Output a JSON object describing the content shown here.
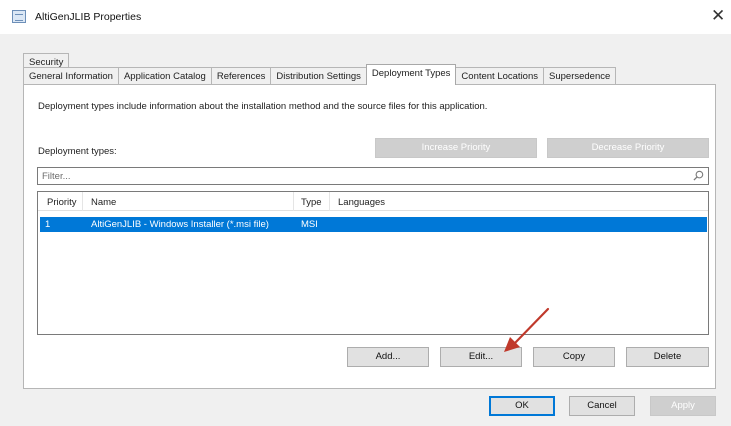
{
  "window": {
    "title": "AltiGenJLIB Properties",
    "close_symbol": "✕"
  },
  "tabs": {
    "row1": [
      {
        "label": "Security"
      }
    ],
    "row2": [
      {
        "label": "General Information"
      },
      {
        "label": "Application Catalog"
      },
      {
        "label": "References"
      },
      {
        "label": "Distribution Settings"
      },
      {
        "label": "Deployment Types",
        "active": true
      },
      {
        "label": "Content Locations"
      },
      {
        "label": "Supersedence"
      }
    ]
  },
  "panel": {
    "description": "Deployment types include information about the installation method and the source files for this application.",
    "deployment_types_label": "Deployment types:",
    "increase_priority_label": "Increase Priority",
    "decrease_priority_label": "Decrease Priority",
    "filter_placeholder": "Filter...",
    "columns": [
      "Priority",
      "Name",
      "Type",
      "Languages"
    ],
    "rows": [
      {
        "priority": "1",
        "name": "AltiGenJLIB - Windows Installer (*.msi file)",
        "type": "MSI",
        "languages": "",
        "selected": true
      }
    ],
    "add_label": "Add...",
    "edit_label": "Edit...",
    "copy_label": "Copy",
    "delete_label": "Delete"
  },
  "footer": {
    "ok_label": "OK",
    "cancel_label": "Cancel",
    "apply_label": "Apply"
  },
  "colors": {
    "selection": "#0078d7",
    "arrow": "#c0392b",
    "dialog_bg": "#f0f0f0"
  },
  "icons": [
    "app-icon",
    "close-icon",
    "search-icon",
    "annotation-arrow"
  ]
}
